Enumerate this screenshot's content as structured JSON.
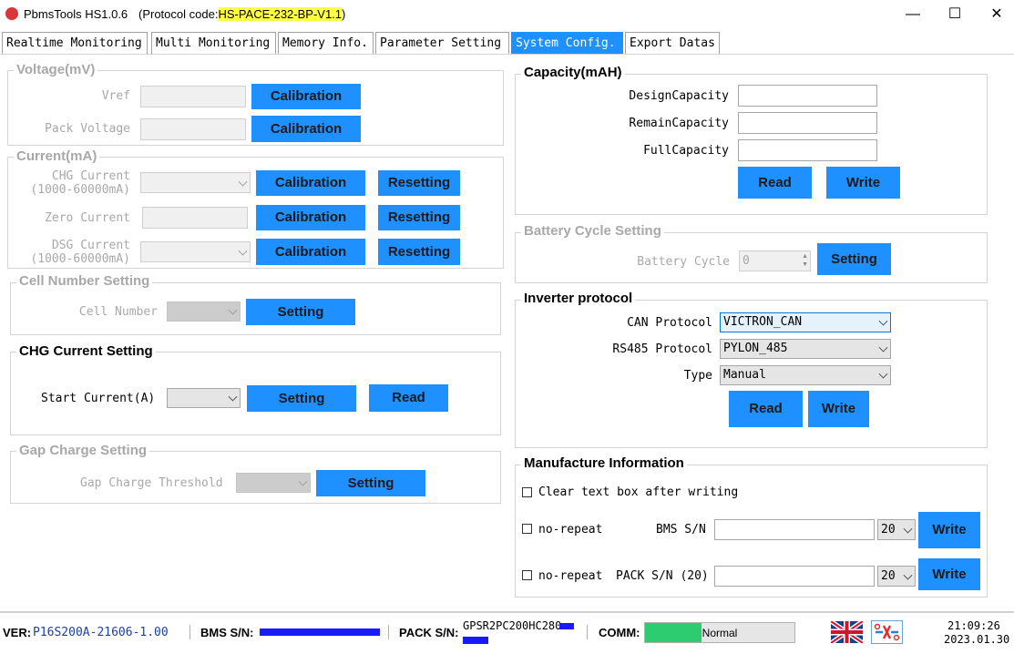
{
  "window": {
    "title": "PbmsTools HS1.0.6",
    "protocol_prefix": "(Protocol code:",
    "protocol_code": "HS-PACE-232-BP-V1.1",
    "protocol_suffix": ")",
    "minimize": "—",
    "maximize": "☐",
    "close": "✕"
  },
  "tabs": [
    {
      "label": "Realtime Monitoring"
    },
    {
      "label": "Multi Monitoring"
    },
    {
      "label": "Memory Info."
    },
    {
      "label": "Parameter Setting"
    },
    {
      "label": "System Config."
    },
    {
      "label": "Export Datas"
    }
  ],
  "voltage": {
    "title": "Voltage(mV)",
    "vref_label": "Vref",
    "pack_label": "Pack Voltage",
    "calibration": "Calibration"
  },
  "current": {
    "title": "Current(mA)",
    "chg_label_1": "CHG Current",
    "chg_label_2": "(1000-60000mA)",
    "zero_label": "Zero Current",
    "dsg_label_1": "DSG Current",
    "dsg_label_2": "(1000-60000mA)",
    "calibration": "Calibration",
    "resetting": "Resetting"
  },
  "cell_number": {
    "title": "Cell Number Setting",
    "label": "Cell Number",
    "setting": "Setting"
  },
  "chg_current_setting": {
    "title": "CHG Current Setting",
    "label": "Start Current(A)",
    "setting": "Setting",
    "read": "Read"
  },
  "gap_charge": {
    "title": "Gap Charge Setting",
    "label": "Gap Charge Threshold",
    "setting": "Setting"
  },
  "capacity": {
    "title": "Capacity(mAH)",
    "design_label": "DesignCapacity",
    "remain_label": "RemainCapacity",
    "full_label": "FullCapacity",
    "read": "Read",
    "write": "Write"
  },
  "battery_cycle": {
    "title": "Battery Cycle Setting",
    "label": "Battery Cycle",
    "value": "0",
    "setting": "Setting"
  },
  "inverter": {
    "title": "Inverter protocol",
    "can_label": "CAN Protocol",
    "can_value": "VICTRON_CAN",
    "rs485_label": "RS485 Protocol",
    "rs485_value": "PYLON_485",
    "type_label": "Type",
    "type_value": "Manual",
    "read": "Read",
    "write": "Write"
  },
  "manufacture": {
    "title": "Manufacture Information",
    "clear_label": "Clear text box after writing",
    "no_repeat": "no-repeat",
    "bms_sn_label": "BMS S/N",
    "pack_sn_label": "PACK S/N (20)",
    "bms_len": "20",
    "pack_len": "20",
    "write": "Write"
  },
  "status": {
    "ver_label": "VER:",
    "ver_value": "P16S200A-21606-1.00",
    "bms_label": "BMS S/N:",
    "pack_label": "PACK S/N:",
    "pack_value": "GPSR2PC200HC280",
    "comm_label": "COMM:",
    "comm_status": "Normal",
    "comm_progress": 0.38,
    "time": "21:09:26",
    "date": "2023.01.30"
  },
  "colors": {
    "accent": "#1e90ff",
    "protocol_highlight": "#ffff44",
    "comm_ok": "#2ecc71",
    "status_text": "#1a3fb0"
  },
  "icons": [
    "app-logo-icon",
    "uk-flag-icon",
    "disconnect-icon"
  ]
}
